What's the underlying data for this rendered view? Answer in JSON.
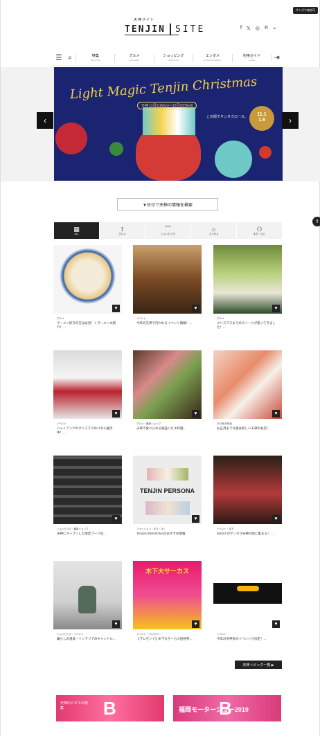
{
  "corner_tag": "サンパウ来訪可",
  "header": {
    "logo_small": "天神サイト",
    "logo_main": "TENJIN",
    "logo_site": "SITE"
  },
  "social": [
    "f",
    "𝕏",
    "◎",
    "℗",
    "⌁"
  ],
  "nav": [
    {
      "label": "特集",
      "sub": "FEATURE"
    },
    {
      "label": "グルメ",
      "sub": "GOURMET"
    },
    {
      "label": "ショッピング",
      "sub": "SHOPPING"
    },
    {
      "label": "エンタメ",
      "sub": "ENTERTAINMENT"
    },
    {
      "label": "利用ガイド",
      "sub": "GUIDE"
    }
  ],
  "hero": {
    "title": "Light Magic Tenjin Christmas",
    "sub": "天神 11月11(Mon)〜12月25(Wed)",
    "line": "この街でサンタクロース。",
    "date_1": "11.1",
    "date_2": "1.6"
  },
  "search_button": "▼日付で天神の情報を検索",
  "tabs": [
    {
      "label": "ALL",
      "icon": "▦"
    },
    {
      "label": "グルメ",
      "icon": "⟟"
    },
    {
      "label": "ショッピング",
      "icon": "⌒"
    },
    {
      "label": "エンタメ",
      "icon": "⌂"
    },
    {
      "label": "まち・ひと",
      "icon": "⚇"
    }
  ],
  "cards": [
    {
      "cat": "グルメ",
      "title": "ラーメン好きの方は必見！トラーメン大紹介！..."
    },
    {
      "cat": "イベント",
      "title": "今年の天神で行われるイベント情報！..."
    },
    {
      "cat": "グルメ",
      "title": "クリスマスまでのスイーツが揃ってきました！..."
    },
    {
      "cat": "イベント",
      "title": "ジャイアンツのクリスマスのパネル展示中！..."
    },
    {
      "cat": "グルメ・最新ショップ",
      "title": "天神で食べられる絶品ジビエ料理..."
    },
    {
      "cat": "2018年末年始",
      "title": "お正月まで今週は新しい天神のお店！"
    },
    {
      "cat": "ショッピング・最新ショップ",
      "title": "天神にオープンした限定ブーツ店..."
    },
    {
      "cat": "ファッション・まち・ひと",
      "title": "TENJIN PERSONAのおすすめ情報"
    },
    {
      "cat": "イベント・まち",
      "title": "5000人のサンタが天神の街に集まる！..."
    },
    {
      "cat": "ショッピング・イベント",
      "title": "暮らしの道具・インテリアのキャンドル..."
    },
    {
      "cat": "イベント・プレゼント",
      "title": "【プレゼント】木下大サーカス招待券..."
    },
    {
      "cat": "イベント",
      "title": "今年の天神冬のイベントが決定！..."
    }
  ],
  "card_persona_text": "TENJIN PERSONA",
  "card_circus_text": "木下大サーカス",
  "more_button": "天神トピック一覧 ▶",
  "banners": [
    {
      "text": "天神のジビエの特集",
      "letter": "B"
    },
    {
      "text": "福岡モーターショー2019",
      "letter": "B"
    }
  ]
}
